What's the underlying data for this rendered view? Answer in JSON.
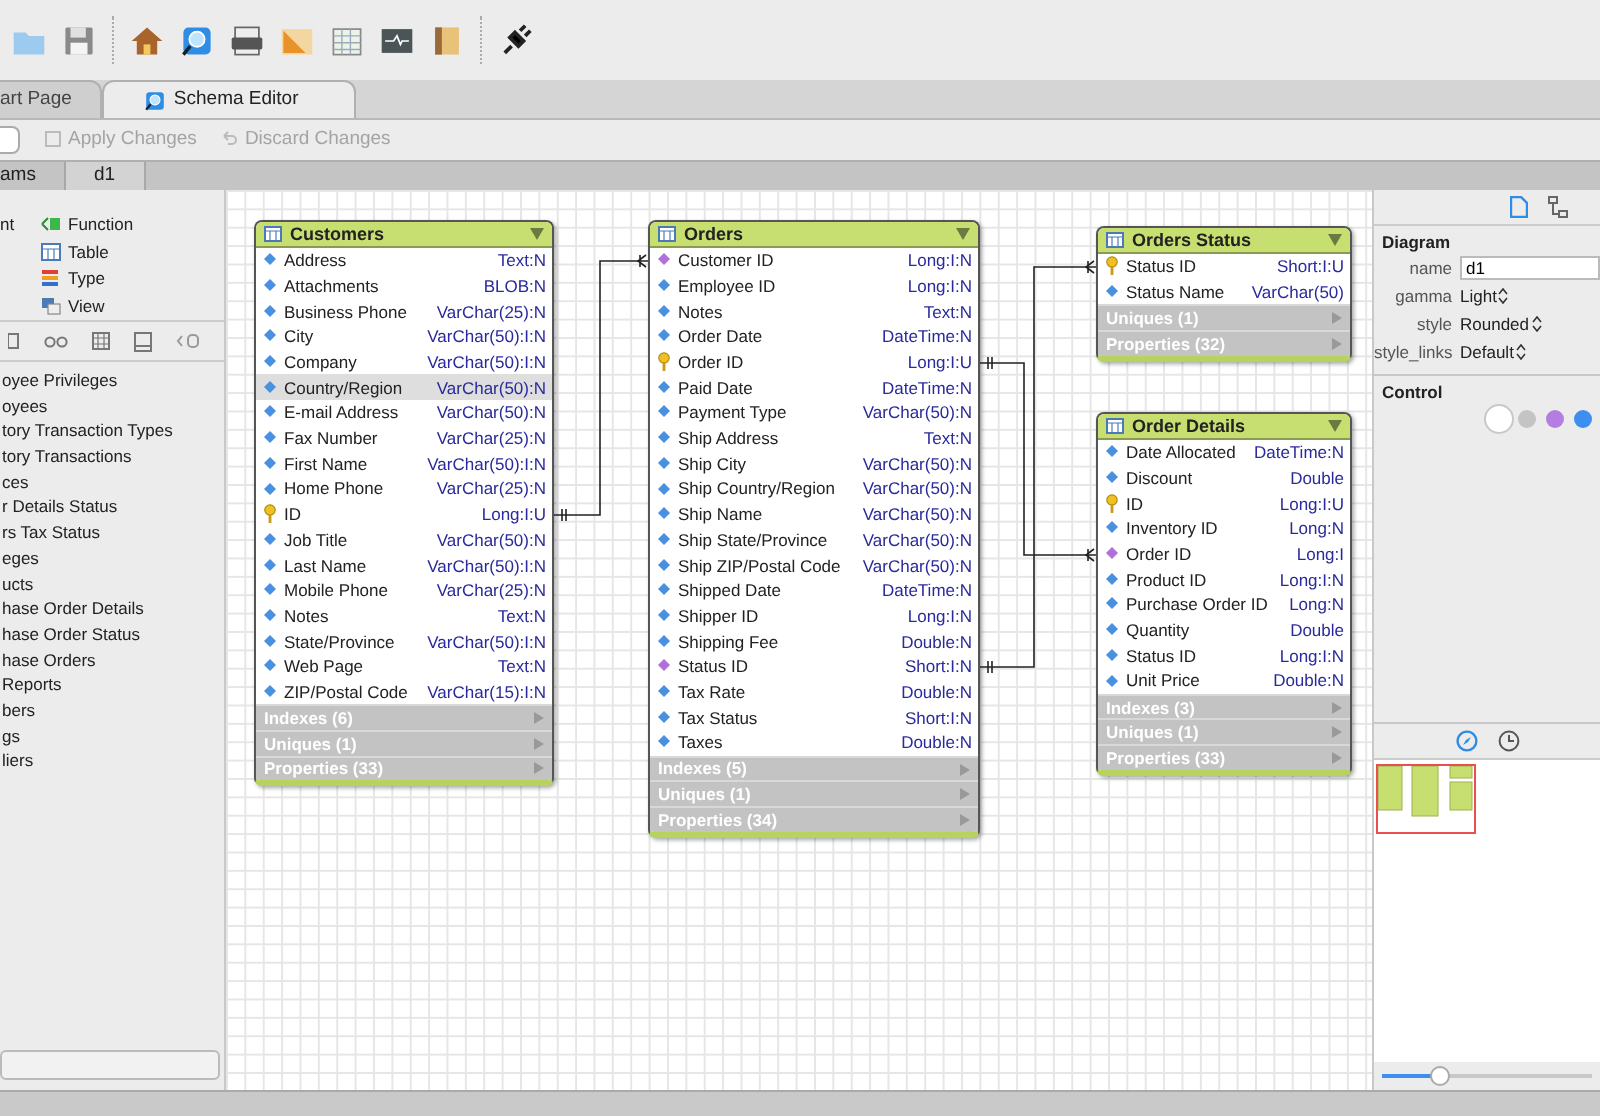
{
  "tabs": [
    {
      "label": "art Page",
      "selected": false
    },
    {
      "label": "Schema Editor",
      "selected": true
    }
  ],
  "actions": [
    {
      "label": "Apply Changes",
      "disabled": true
    },
    {
      "label": "Discard Changes",
      "disabled": true
    }
  ],
  "doc_tabs": [
    {
      "label": "ams",
      "selected": false
    },
    {
      "label": "d1",
      "selected": true
    }
  ],
  "object_types_cut": [
    "nt"
  ],
  "object_types": [
    {
      "label": "Function",
      "kind": "function"
    },
    {
      "label": "Table",
      "kind": "table"
    },
    {
      "label": "Type",
      "kind": "type"
    },
    {
      "label": "View",
      "kind": "view"
    }
  ],
  "tables_list": [
    "oyee Privileges",
    "oyees",
    "tory Transaction Types",
    "tory Transactions",
    "ces",
    "r Details Status",
    "rs Tax Status",
    "eges",
    "ucts",
    "hase Order Details",
    "hase Order Status",
    "hase Orders",
    "Reports",
    "bers",
    "gs",
    "liers"
  ],
  "entities": [
    {
      "title": "Customers",
      "columns": [
        {
          "name": "Address",
          "type": "Text:N",
          "kind": "field",
          "selected": false
        },
        {
          "name": "Attachments",
          "type": "BLOB:N",
          "kind": "field",
          "selected": false
        },
        {
          "name": "Business Phone",
          "type": "VarChar(25):N",
          "kind": "field",
          "selected": false
        },
        {
          "name": "City",
          "type": "VarChar(50):I:N",
          "kind": "field",
          "selected": false
        },
        {
          "name": "Company",
          "type": "VarChar(50):I:N",
          "kind": "field",
          "selected": false
        },
        {
          "name": "Country/Region",
          "type": "VarChar(50):N",
          "kind": "field",
          "selected": true
        },
        {
          "name": "E-mail Address",
          "type": "VarChar(50):N",
          "kind": "field",
          "selected": false
        },
        {
          "name": "Fax Number",
          "type": "VarChar(25):N",
          "kind": "field",
          "selected": false
        },
        {
          "name": "First Name",
          "type": "VarChar(50):I:N",
          "kind": "field",
          "selected": false
        },
        {
          "name": "Home Phone",
          "type": "VarChar(25):N",
          "kind": "field",
          "selected": false
        },
        {
          "name": "ID",
          "type": "Long:I:U",
          "kind": "primary",
          "selected": false
        },
        {
          "name": "Job Title",
          "type": "VarChar(50):N",
          "kind": "field",
          "selected": false
        },
        {
          "name": "Last Name",
          "type": "VarChar(50):I:N",
          "kind": "field",
          "selected": false
        },
        {
          "name": "Mobile Phone",
          "type": "VarChar(25):N",
          "kind": "field",
          "selected": false
        },
        {
          "name": "Notes",
          "type": "Text:N",
          "kind": "field",
          "selected": false
        },
        {
          "name": "State/Province",
          "type": "VarChar(50):I:N",
          "kind": "field",
          "selected": false
        },
        {
          "name": "Web Page",
          "type": "Text:N",
          "kind": "field",
          "selected": false
        },
        {
          "name": "ZIP/Postal Code",
          "type": "VarChar(15):I:N",
          "kind": "field",
          "selected": false
        }
      ],
      "sections": [
        "Indexes (6)",
        "Uniques (1)",
        "Properties (33)"
      ]
    },
    {
      "title": "Orders",
      "columns": [
        {
          "name": "Customer ID",
          "type": "Long:I:N",
          "kind": "foreign",
          "selected": false
        },
        {
          "name": "Employee ID",
          "type": "Long:I:N",
          "kind": "field",
          "selected": false
        },
        {
          "name": "Notes",
          "type": "Text:N",
          "kind": "field",
          "selected": false
        },
        {
          "name": "Order Date",
          "type": "DateTime:N",
          "kind": "field",
          "selected": false
        },
        {
          "name": "Order ID",
          "type": "Long:I:U",
          "kind": "primary",
          "selected": false
        },
        {
          "name": "Paid Date",
          "type": "DateTime:N",
          "kind": "field",
          "selected": false
        },
        {
          "name": "Payment Type",
          "type": "VarChar(50):N",
          "kind": "field",
          "selected": false
        },
        {
          "name": "Ship Address",
          "type": "Text:N",
          "kind": "field",
          "selected": false
        },
        {
          "name": "Ship City",
          "type": "VarChar(50):N",
          "kind": "field",
          "selected": false
        },
        {
          "name": "Ship Country/Region",
          "type": "VarChar(50):N",
          "kind": "field",
          "selected": false
        },
        {
          "name": "Ship Name",
          "type": "VarChar(50):N",
          "kind": "field",
          "selected": false
        },
        {
          "name": "Ship State/Province",
          "type": "VarChar(50):N",
          "kind": "field",
          "selected": false
        },
        {
          "name": "Ship ZIP/Postal Code",
          "type": "VarChar(50):N",
          "kind": "field",
          "selected": false
        },
        {
          "name": "Shipped Date",
          "type": "DateTime:N",
          "kind": "field",
          "selected": false
        },
        {
          "name": "Shipper ID",
          "type": "Long:I:N",
          "kind": "field",
          "selected": false
        },
        {
          "name": "Shipping Fee",
          "type": "Double:N",
          "kind": "field",
          "selected": false
        },
        {
          "name": "Status ID",
          "type": "Short:I:N",
          "kind": "foreign",
          "selected": false
        },
        {
          "name": "Tax Rate",
          "type": "Double:N",
          "kind": "field",
          "selected": false
        },
        {
          "name": "Tax Status",
          "type": "Short:I:N",
          "kind": "field",
          "selected": false
        },
        {
          "name": "Taxes",
          "type": "Double:N",
          "kind": "field",
          "selected": false
        }
      ],
      "sections": [
        "Indexes (5)",
        "Uniques (1)",
        "Properties (34)"
      ]
    },
    {
      "title": "Orders Status",
      "columns": [
        {
          "name": "Status ID",
          "type": "Short:I:U",
          "kind": "primary",
          "selected": false
        },
        {
          "name": "Status Name",
          "type": "VarChar(50)",
          "kind": "field",
          "selected": false
        }
      ],
      "sections": [
        "Uniques (1)",
        "Properties (32)"
      ]
    },
    {
      "title": "Order Details",
      "columns": [
        {
          "name": "Date Allocated",
          "type": "DateTime:N",
          "kind": "field",
          "selected": false
        },
        {
          "name": "Discount",
          "type": "Double",
          "kind": "field",
          "selected": false
        },
        {
          "name": "ID",
          "type": "Long:I:U",
          "kind": "primary",
          "selected": false
        },
        {
          "name": "Inventory ID",
          "type": "Long:N",
          "kind": "field",
          "selected": false
        },
        {
          "name": "Order ID",
          "type": "Long:I",
          "kind": "foreign",
          "selected": false
        },
        {
          "name": "Product ID",
          "type": "Long:I:N",
          "kind": "field",
          "selected": false
        },
        {
          "name": "Purchase Order ID",
          "type": "Long:N",
          "kind": "field",
          "selected": false
        },
        {
          "name": "Quantity",
          "type": "Double",
          "kind": "field",
          "selected": false
        },
        {
          "name": "Status ID",
          "type": "Long:I:N",
          "kind": "field",
          "selected": false
        },
        {
          "name": "Unit Price",
          "type": "Double:N",
          "kind": "field",
          "selected": false
        }
      ],
      "sections": [
        "Indexes (3)",
        "Uniques (1)",
        "Properties (33)"
      ]
    }
  ],
  "inspector": {
    "view_tabs": [
      {
        "selected": true
      },
      {
        "selected": false
      }
    ],
    "heading": "Diagram",
    "properties": [
      {
        "label": "name",
        "value": "d1",
        "kind": "text"
      },
      {
        "label": "gamma",
        "value": "Light",
        "kind": "select"
      },
      {
        "label": "style",
        "value": "Rounded",
        "kind": "select"
      },
      {
        "label": "style_links",
        "value": "Default",
        "kind": "select"
      }
    ],
    "control_heading": "Control",
    "colors": [
      {
        "color": "#ffffff",
        "selected": true
      },
      {
        "color": "#c4c4c4",
        "selected": false
      },
      {
        "color": "#b47ee0",
        "selected": false
      },
      {
        "color": "#3e8ef0",
        "selected": false
      }
    ]
  },
  "navigator": {
    "view_tabs": [
      {
        "selected": true
      },
      {
        "selected": false
      }
    ],
    "zoom": {
      "level": 0.28
    }
  }
}
